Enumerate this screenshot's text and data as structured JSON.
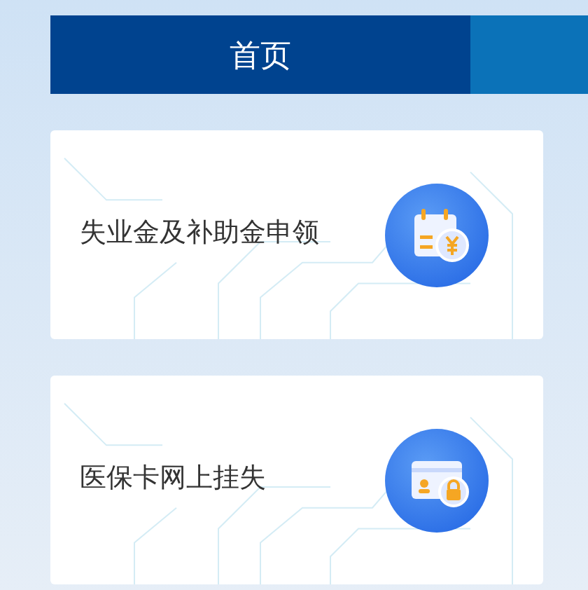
{
  "tabs": [
    {
      "label": "首页",
      "selected": true
    },
    {
      "selected": false
    }
  ],
  "services": [
    {
      "title": "失业金及补助金申领",
      "kind": "allowance"
    },
    {
      "title": "医保卡网上挂失",
      "kind": "card-loss"
    }
  ]
}
